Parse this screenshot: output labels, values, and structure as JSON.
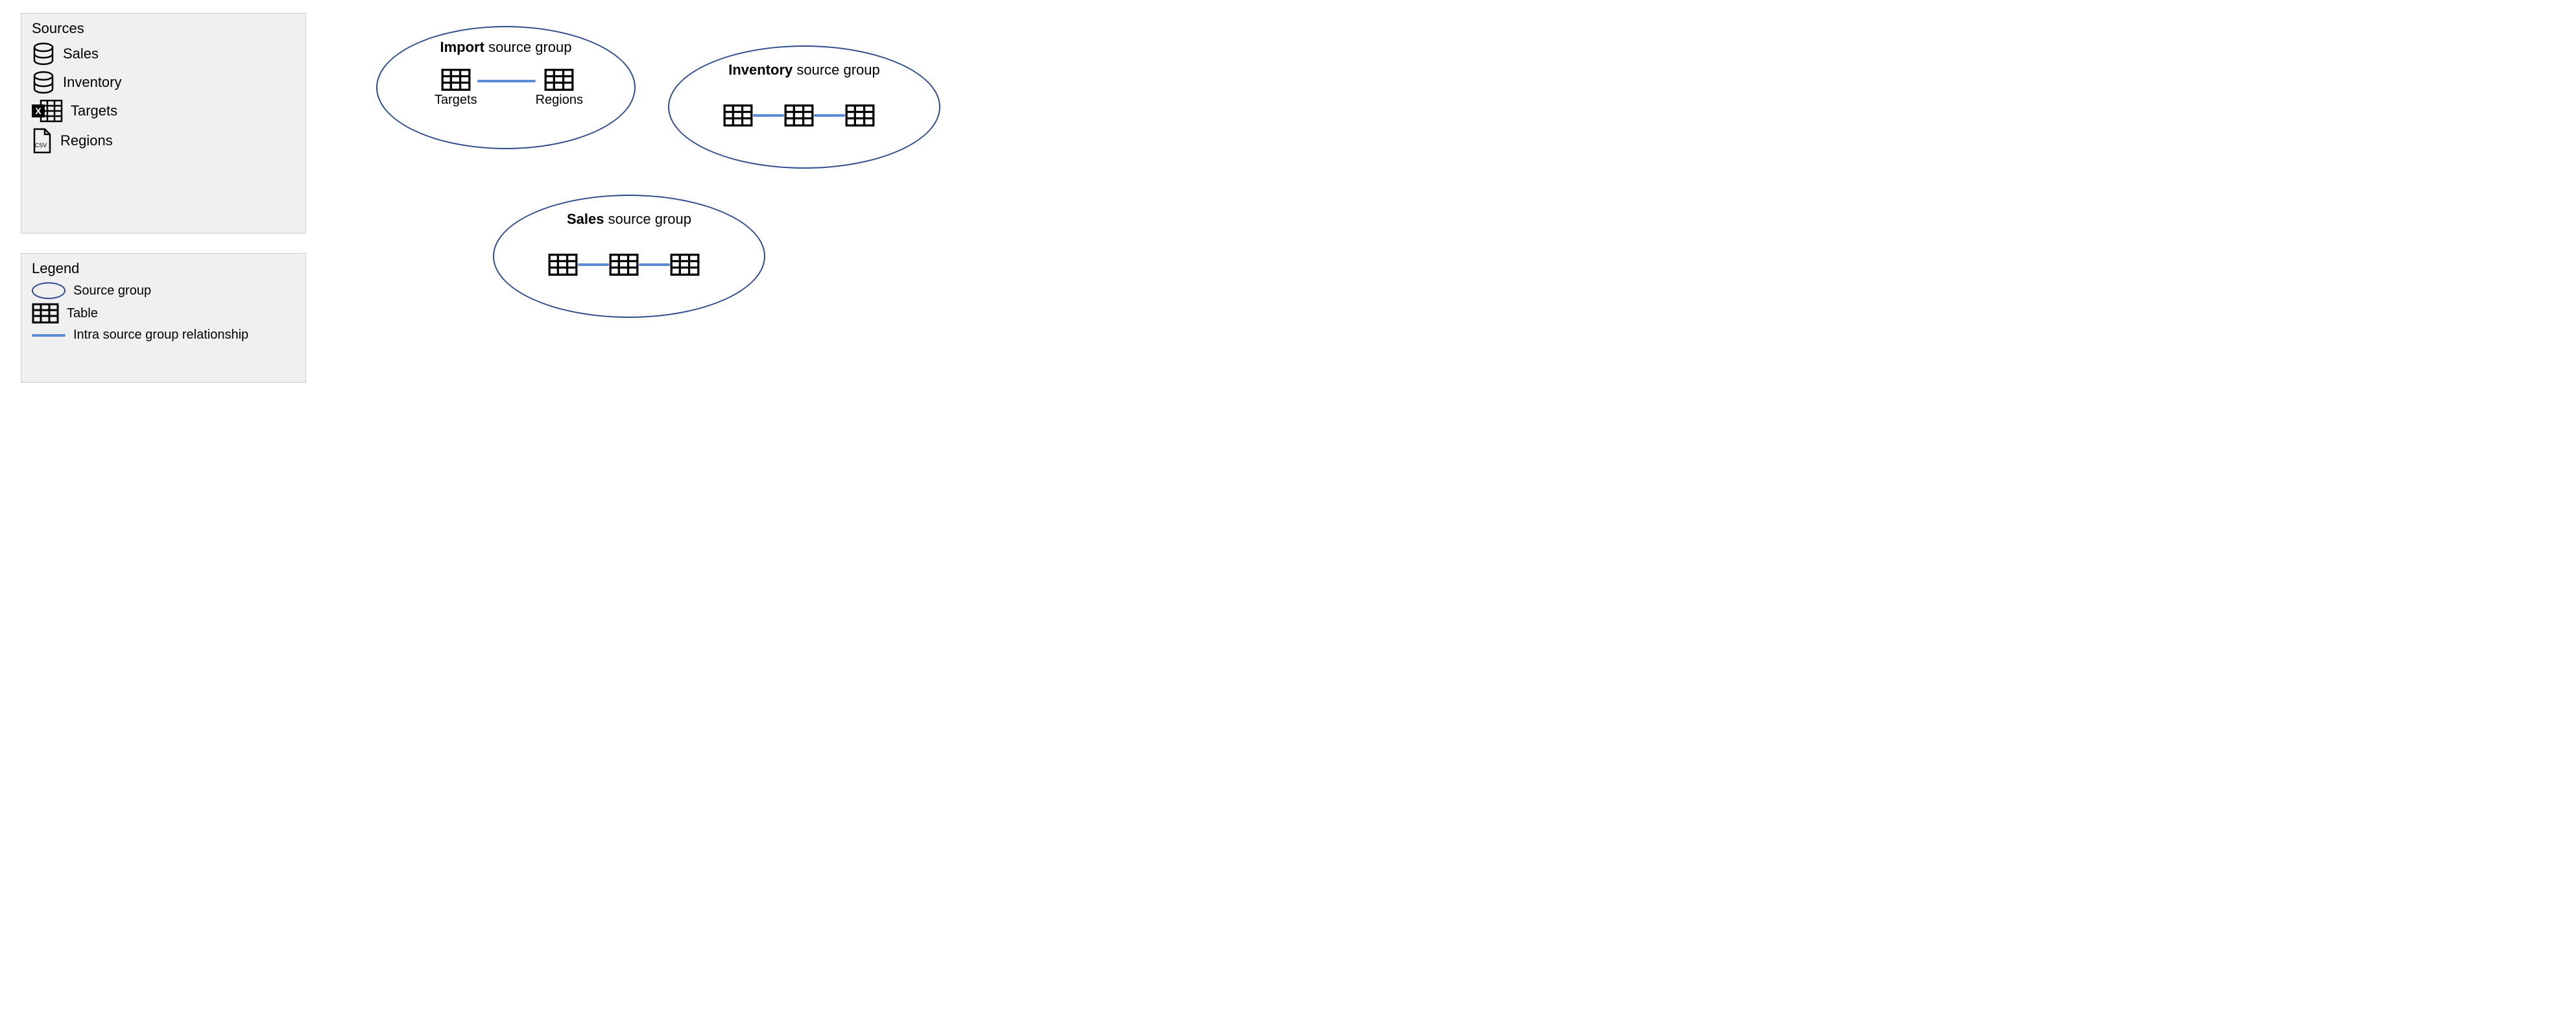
{
  "sources_panel": {
    "title": "Sources",
    "items": [
      {
        "type": "database",
        "label": "Sales"
      },
      {
        "type": "database",
        "label": "Inventory"
      },
      {
        "type": "excel",
        "label": "Targets"
      },
      {
        "type": "csv",
        "label": "Regions"
      }
    ]
  },
  "legend_panel": {
    "title": "Legend",
    "ellipse_label": "Source group",
    "table_label": "Table",
    "line_label": "Intra source group relationship"
  },
  "groups": {
    "import": {
      "title_bold": "Import",
      "title_rest": " source group",
      "tables": [
        "Targets",
        "Regions"
      ]
    },
    "inventory": {
      "title_bold": "Inventory",
      "title_rest": " source group"
    },
    "sales": {
      "title_bold": "Sales",
      "title_rest": " source group"
    }
  }
}
